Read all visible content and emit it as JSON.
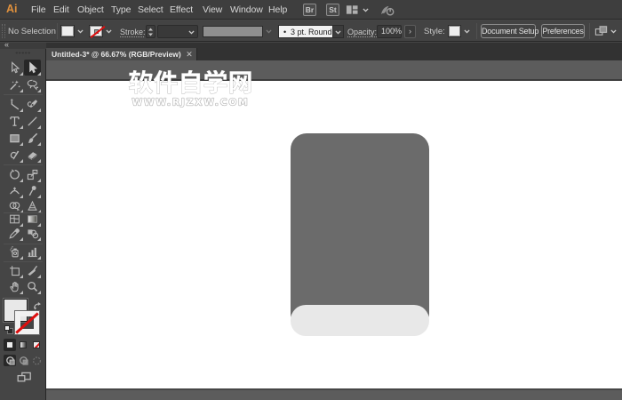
{
  "app": {
    "logo": "Ai",
    "name": "Adobe Illustrator"
  },
  "menubar": {
    "items": [
      "File",
      "Edit",
      "Object",
      "Type",
      "Select",
      "Effect",
      "View",
      "Window",
      "Help"
    ],
    "bridge_label": "Br",
    "stock_label": "St"
  },
  "controlbar": {
    "selection_status": "No Selection",
    "stroke_label": "Stroke:",
    "brush_bullet": "•",
    "brush_definition": "3 pt. Round",
    "opacity_label": "Opacity:",
    "opacity_value": "100%",
    "more_arrow": "›",
    "style_label": "Style:",
    "document_setup_label": "Document Setup",
    "preferences_label": "Preferences"
  },
  "document": {
    "tab_title": "Untitled-3* @ 66.67% (RGB/Preview)",
    "close_glyph": "✕",
    "zoom_level": "66.67%",
    "color_mode": "RGB/Preview"
  },
  "watermark": {
    "title": "软件自学网",
    "url": "WWW.RJZXW.COM"
  },
  "toolbar": {
    "collapse_glyph": "«",
    "active_tool": "direct-selection",
    "rows": [
      {
        "left": "selection",
        "right": "direct-selection",
        "divider_after": false
      },
      {
        "left": "magic-wand",
        "right": "lasso",
        "divider_after": true
      },
      {
        "left": "curvature",
        "right": "pen",
        "divider_after": false
      },
      {
        "left": "type",
        "right": "line-segment",
        "divider_after": false
      },
      {
        "left": "rectangle",
        "right": "paintbrush",
        "divider_after": false
      },
      {
        "left": "shaper",
        "right": "eraser",
        "divider_after": true
      },
      {
        "left": "rotate",
        "right": "scale",
        "divider_after": false
      },
      {
        "left": "width",
        "right": "puppet-warp",
        "divider_after": false
      },
      {
        "left": "shape-builder",
        "right": "perspective-grid",
        "divider_after": true
      },
      {
        "left": "mesh",
        "right": "gradient",
        "divider_after": false
      },
      {
        "left": "eyedropper",
        "right": "blend",
        "divider_after": true
      },
      {
        "left": "symbol-sprayer",
        "right": "column-graph",
        "divider_after": true
      },
      {
        "left": "artboard",
        "right": "slice",
        "divider_after": false
      },
      {
        "left": "hand",
        "right": "zoom",
        "divider_after": false
      }
    ],
    "fill_color": "#E8E8E8",
    "stroke_style": "none"
  },
  "canvas": {
    "artboard_color": "#FFFFFF",
    "pasteboard_color": "#5C5C5C",
    "shape": {
      "kind": "rounded-rectangle book",
      "cover_color": "#6B6B6B",
      "band_color": "#E8E8E8"
    }
  },
  "colors": {
    "ui_dark": "#3E3E3E",
    "ui_panel": "#454545",
    "accent_logo": "#E0913D",
    "none_red": "#DD0E0E"
  }
}
